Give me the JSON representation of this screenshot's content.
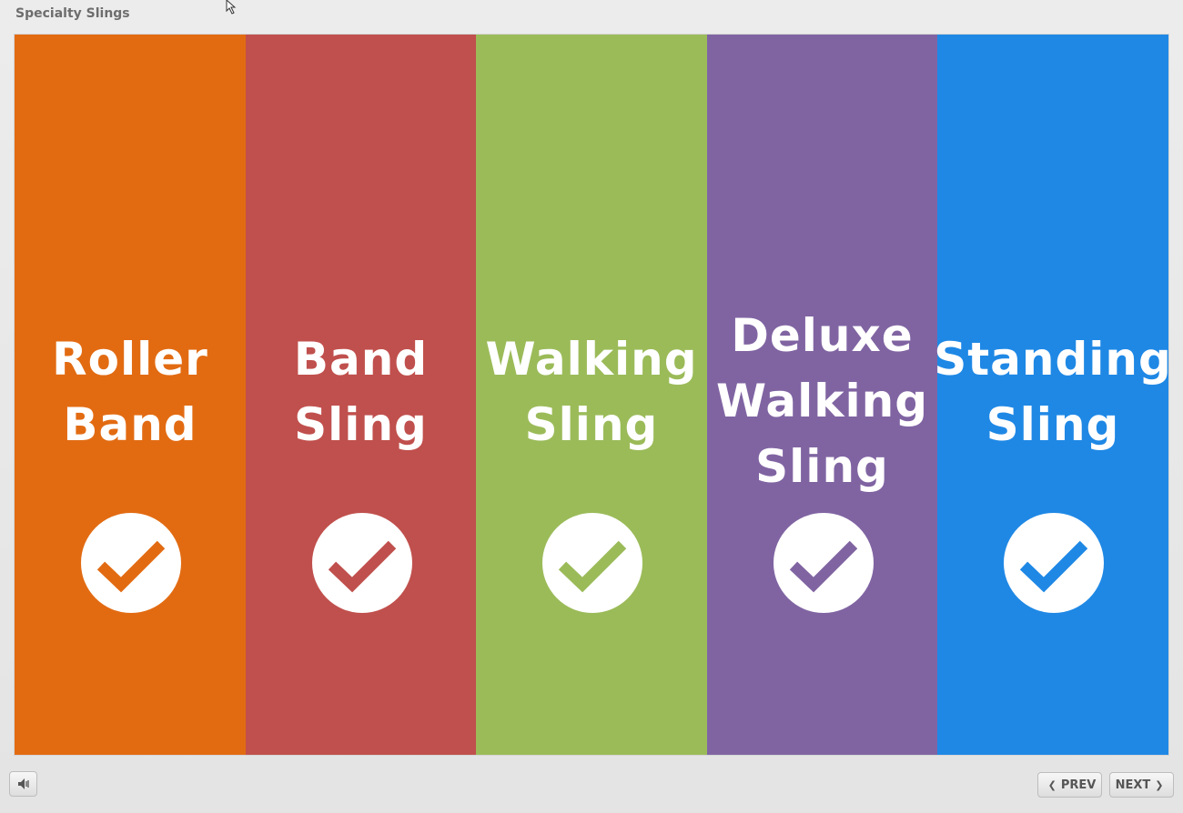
{
  "title": "Specialty Slings",
  "panels": [
    {
      "label": "Roller\nBand",
      "color": "#e26b12"
    },
    {
      "label": "Band\nSling",
      "color": "#c0504d"
    },
    {
      "label": "Walking\nSling",
      "color": "#9bbb59"
    },
    {
      "label": "Deluxe\nWalking\nSling",
      "color": "#8064a2"
    },
    {
      "label": "Standing\nSling",
      "color": "#1f88e5"
    }
  ],
  "icons": {
    "panel_check": "check-circle-icon",
    "audio": "speaker-icon",
    "prev": "chevron-left-icon",
    "next": "chevron-right-icon"
  },
  "nav": {
    "prev_label": "PREV",
    "next_label": "NEXT"
  }
}
